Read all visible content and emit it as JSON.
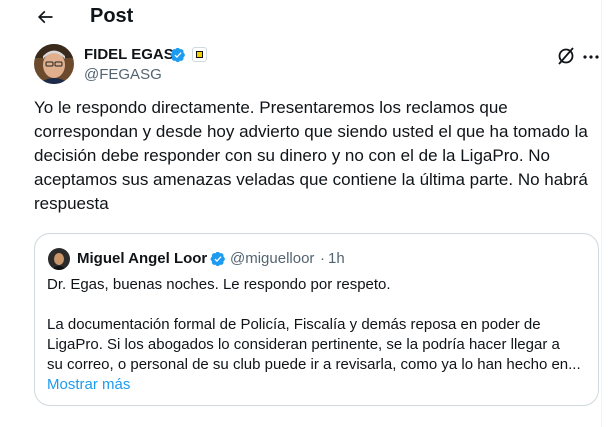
{
  "header": {
    "title": "Post"
  },
  "post": {
    "author_name": "FIDEL EGAS",
    "author_handle": "@FEGASG",
    "text": "Yo le respondo directamente. Presentaremos los reclamos que correspondan y desde hoy advierto que siendo usted el que ha tomado la decisión debe responder con su dinero y no con el de la LigaPro. No aceptamos sus amenazas veladas que contiene la última parte. No habrá respuesta"
  },
  "quote": {
    "author_name": "Miguel Angel Loor",
    "author_handle": "@miguelloor",
    "separator": "·",
    "time": "1h",
    "line1": "Dr. Egas, buenas noches. Le respondo por respeto.",
    "paragraph_lines": [
      "La documentación formal de Policía, Fiscalía y demás reposa en poder de",
      "LigaPro. Si los abogados lo consideran pertinente, se la podría hacer llegar a",
      "su correo, o personal de su club puede ir a revisarla, como ya lo han hecho en..."
    ],
    "show_more": "Mostrar más"
  },
  "colors": {
    "accent": "#1d9bf0",
    "secondary_text": "#536471",
    "border": "#cfd9de",
    "affiliation": "#f5d000"
  }
}
